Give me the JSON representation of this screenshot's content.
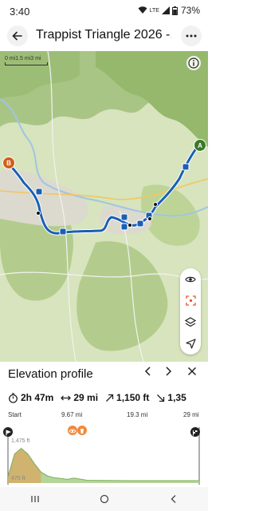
{
  "status": {
    "time": "3:40",
    "network": "LTE",
    "battery": "73%"
  },
  "header": {
    "title": "Trappist Triangle 2026 -..."
  },
  "map": {
    "scale_label": "0 mi1.5 mi3 mi",
    "start_marker": "A",
    "end_marker": "B",
    "route_color": "#1a5fb4"
  },
  "elevation": {
    "title": "Elevation profile",
    "stats": {
      "duration": "2h 47m",
      "distance": "29 mi",
      "ascent": "1,150 ft",
      "descent": "1,35"
    },
    "distance_labels": [
      "Start",
      "9.67 mi",
      "19.3 mi",
      "29 mi"
    ],
    "ft_labels": [
      "1,475 ft",
      "475 ft"
    ]
  },
  "colors": {
    "accent_orange": "#f08a3c",
    "profile_fill": "#b5d59a"
  },
  "chart_data": {
    "type": "area",
    "x": [
      0,
      1,
      2,
      3,
      4,
      5,
      6,
      7,
      8,
      9,
      10,
      12,
      15,
      18,
      21,
      24,
      27,
      29
    ],
    "y": [
      620,
      1150,
      1280,
      1150,
      930,
      730,
      640,
      600,
      580,
      560,
      590,
      540,
      535,
      530,
      530,
      530,
      530,
      530
    ],
    "xlabel": "",
    "ylabel": "",
    "ylim": [
      475,
      1475
    ],
    "xlim": [
      0,
      29
    ]
  }
}
